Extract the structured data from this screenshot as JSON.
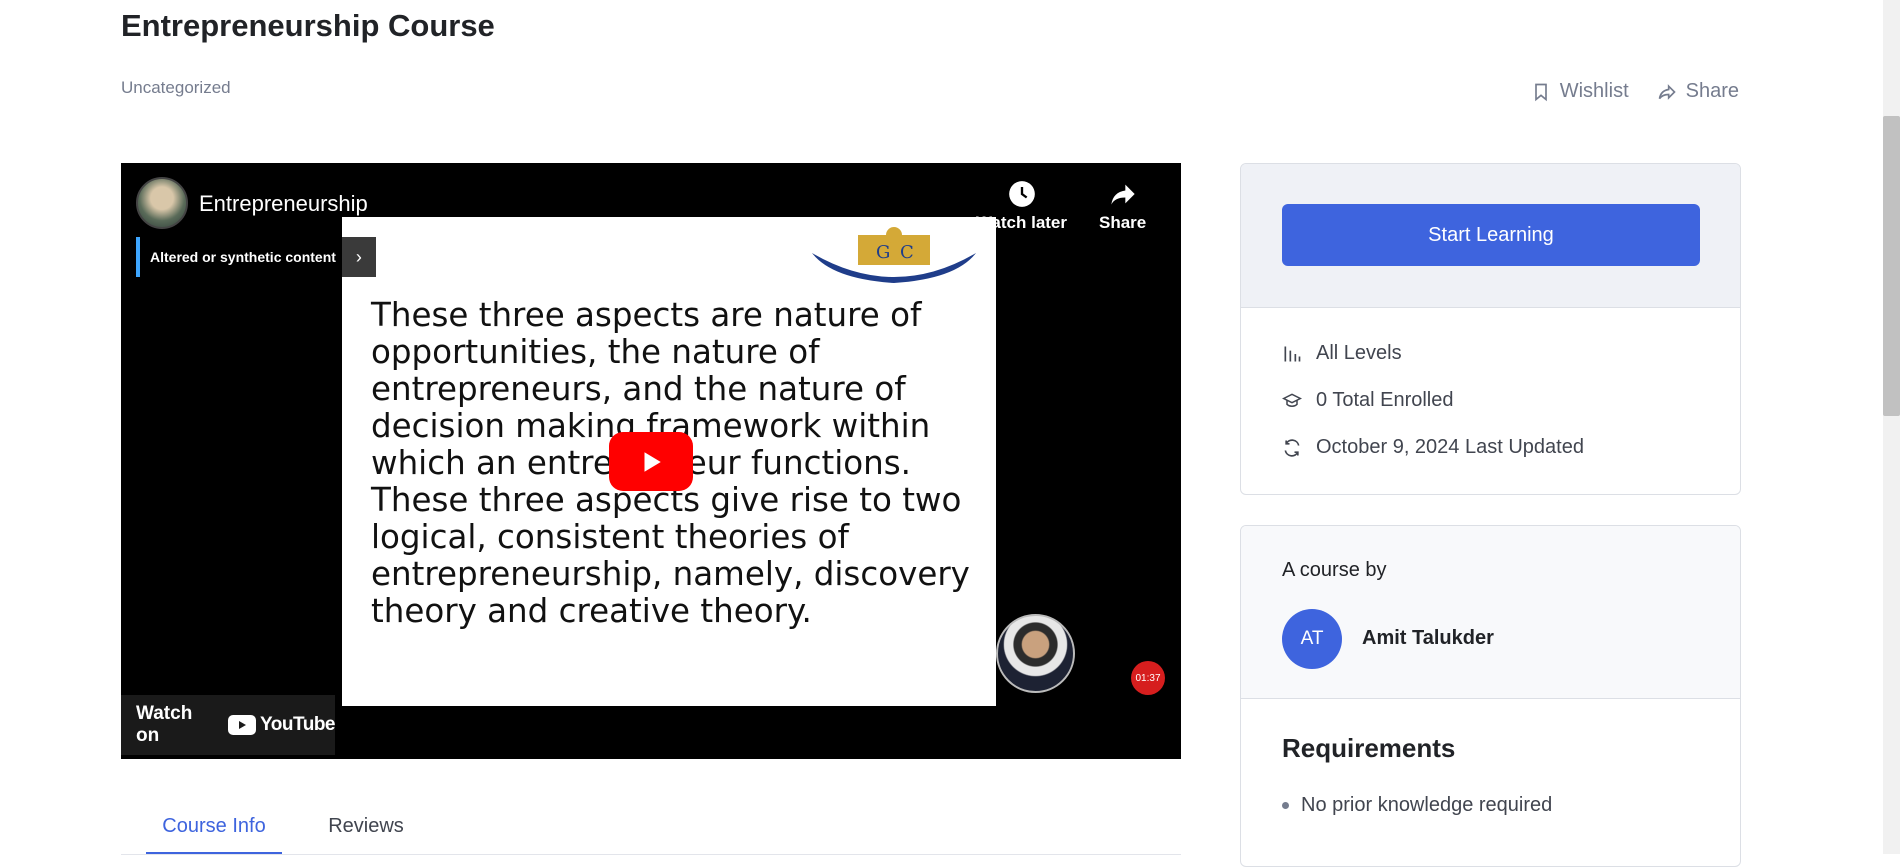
{
  "course": {
    "title": "Entrepreneurship Course",
    "category": "Uncategorized"
  },
  "actions": {
    "wishlist": "Wishlist",
    "share": "Share"
  },
  "video": {
    "channel_title": "Entrepreneurship",
    "watch_later": "Watch later",
    "share": "Share",
    "synthetic_notice": "Altered or synthetic content",
    "slide_text": "These three aspects are nature of opportunities, the nature of entrepreneurs, and the nature of decision making framework within which an entrepreneur functions. These three aspects give rise to two logical, consistent theories of entrepreneurship, namely, discovery theory and creative theory.",
    "timer": "01:37",
    "watch_on": "Watch on",
    "youtube": "YouTube"
  },
  "tabs": [
    {
      "label": "Course Info",
      "active": true
    },
    {
      "label": "Reviews",
      "active": false
    }
  ],
  "sidebar": {
    "start_button": "Start Learning",
    "meta": [
      {
        "icon": "levels-icon",
        "text": "All Levels"
      },
      {
        "icon": "graduation-cap-icon",
        "text": "0 Total Enrolled"
      },
      {
        "icon": "refresh-icon",
        "text": "October 9, 2024 Last Updated"
      }
    ],
    "author_label": "A course by",
    "author_initials": "AT",
    "author_name": "Amit Talukder",
    "requirements_title": "Requirements",
    "requirements": [
      "No prior knowledge required"
    ]
  },
  "colors": {
    "accent": "#3e64de",
    "youtube_red": "#ff0000"
  }
}
